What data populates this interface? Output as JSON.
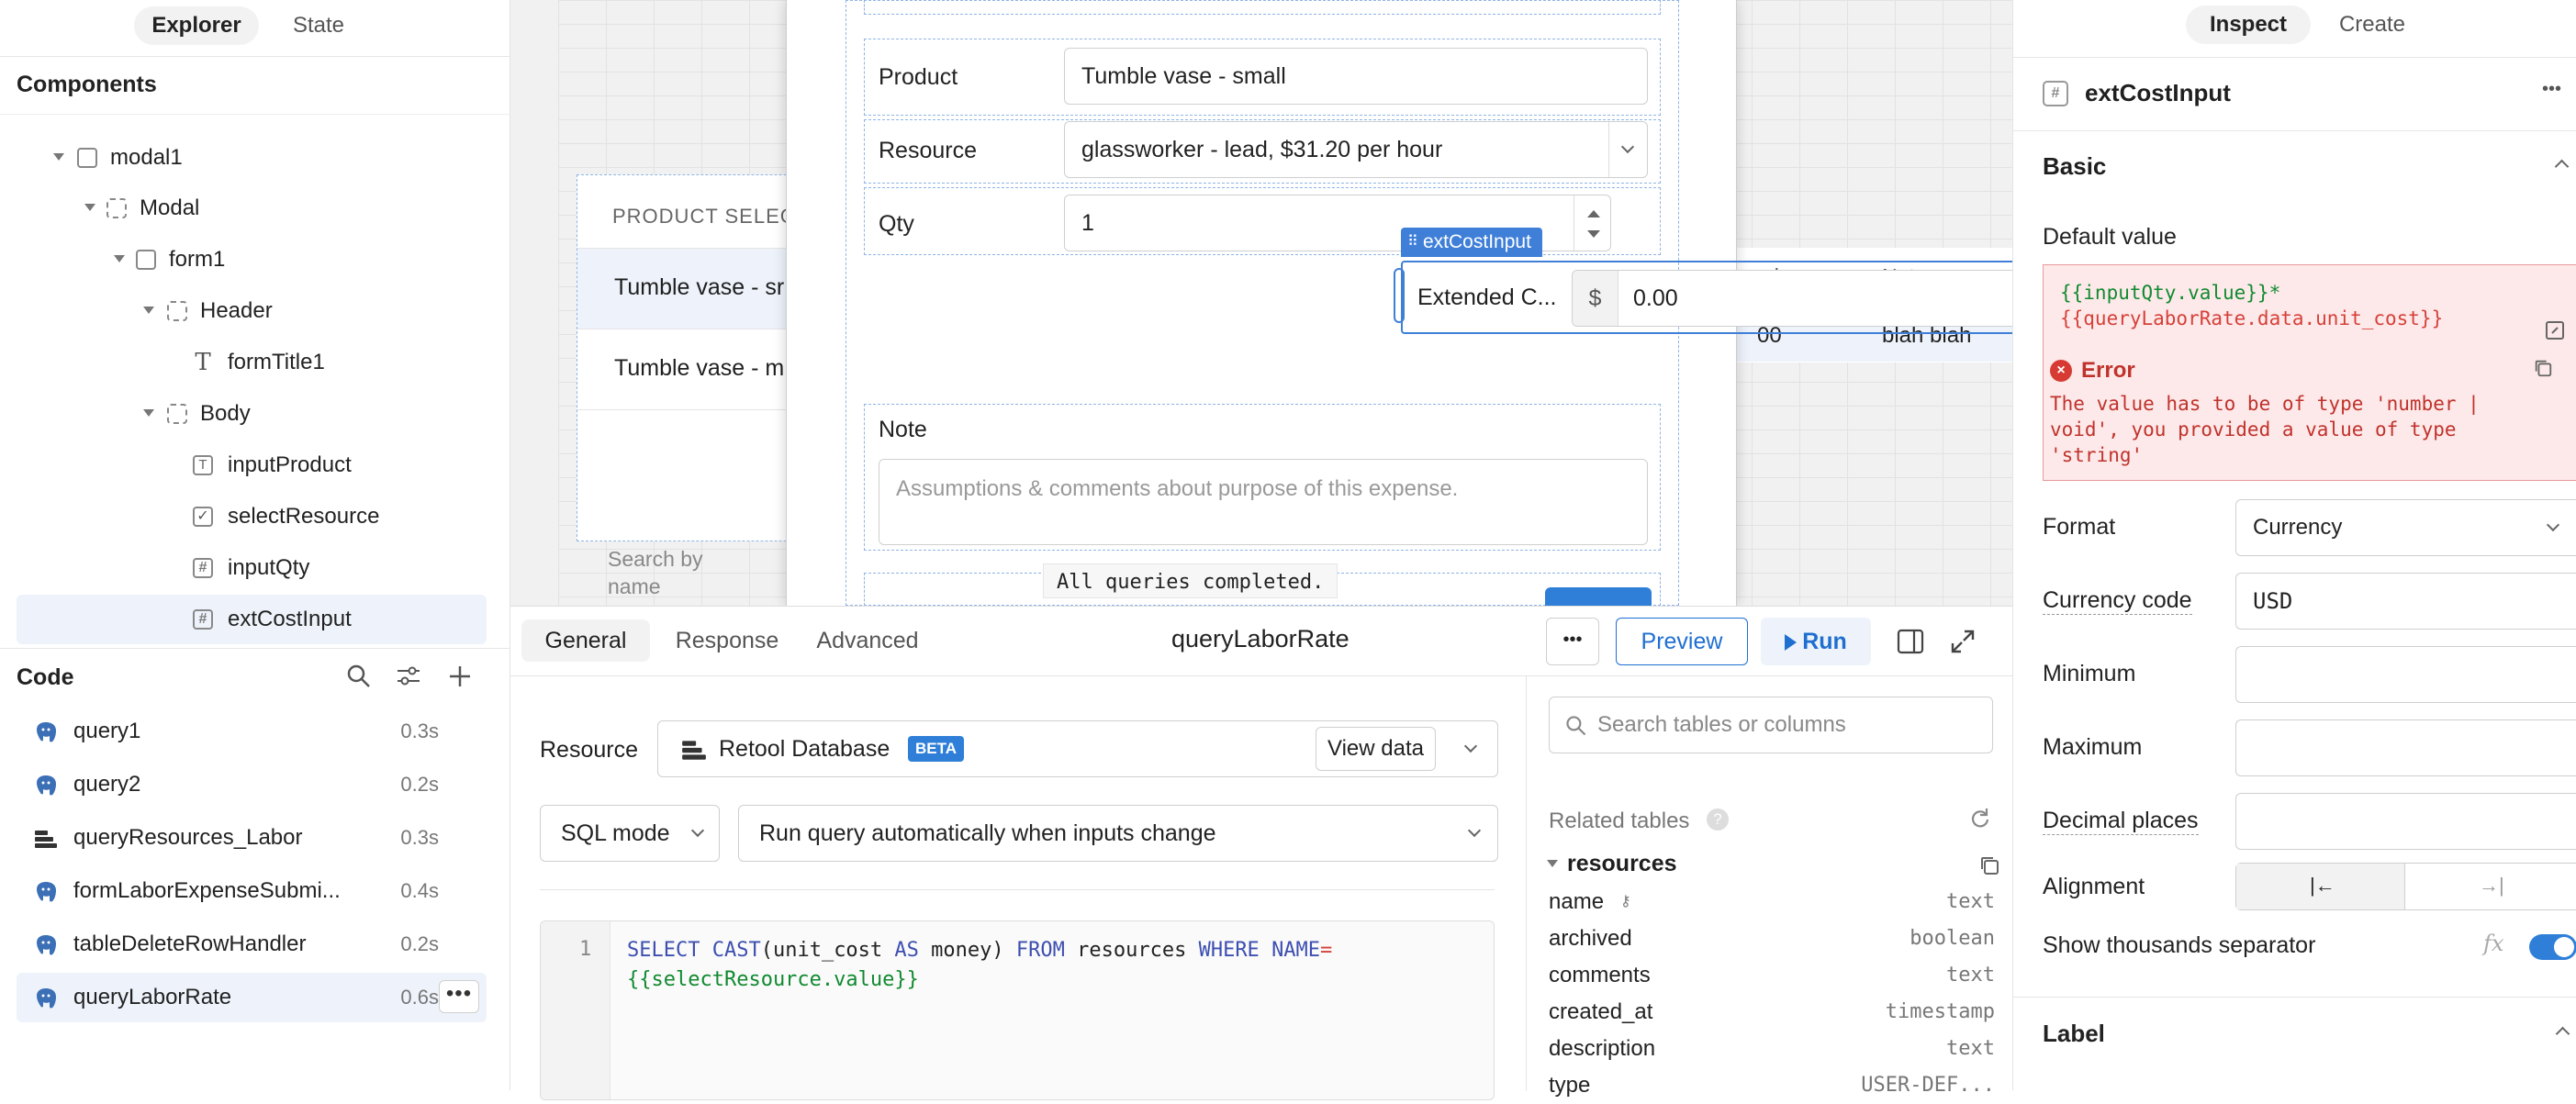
{
  "explorer": {
    "tabs": [
      "Explorer",
      "State"
    ],
    "components_title": "Components",
    "tree": [
      "modal1",
      "Modal",
      "form1",
      "Header",
      "formTitle1",
      "Body",
      "inputProduct",
      "selectResource",
      "inputQty",
      "extCostInput"
    ]
  },
  "code": {
    "title": "Code",
    "queries": [
      {
        "name": "query1",
        "time": "0.3s"
      },
      {
        "name": "query2",
        "time": "0.2s"
      },
      {
        "name": "queryResources_Labor",
        "time": "0.3s"
      },
      {
        "name": "formLaborExpenseSubmi...",
        "time": "0.4s"
      },
      {
        "name": "tableDeleteRowHandler",
        "time": "0.2s"
      },
      {
        "name": "queryLaborRate",
        "time": "0.6s"
      }
    ]
  },
  "canvas": {
    "table_header": "PRODUCT SELEC",
    "table_rows": [
      "Tumble vase - sr",
      "Tumble vase - m"
    ],
    "search_placeholder": "Search by name",
    "right_table_headers": [
      "al",
      "Note"
    ],
    "right_table_row": [
      "00",
      "blah blah"
    ],
    "toast": "All queries completed.",
    "form": {
      "product_label": "Product",
      "product_value": "Tumble vase - small",
      "resource_label": "Resource",
      "resource_value": "glassworker - lead, $31.20 per hour",
      "qty_label": "Qty",
      "qty_value": "1",
      "ext_label": "Extended C...",
      "currency_symbol": "$",
      "ext_value": "0.00",
      "selected_tag": "extCostInput",
      "note_label": "Note",
      "note_placeholder": "Assumptions & comments about purpose of this expense."
    }
  },
  "query_editor": {
    "tabs": [
      "General",
      "Response",
      "Advanced"
    ],
    "name": "queryLaborRate",
    "more": "•••",
    "preview": "Preview",
    "run": "Run",
    "resource_label": "Resource",
    "resource_value": "Retool Database",
    "beta": "BETA",
    "view_data": "View data",
    "mode": "SQL mode",
    "trigger": "Run query automatically when inputs change",
    "line_number": "1",
    "search_placeholder": "Search tables or columns",
    "related_tables": "Related tables",
    "table_name": "resources",
    "columns": [
      {
        "name": "name",
        "type": "text"
      },
      {
        "name": "archived",
        "type": "boolean"
      },
      {
        "name": "comments",
        "type": "text"
      },
      {
        "name": "created_at",
        "type": "timestamp"
      },
      {
        "name": "description",
        "type": "text"
      },
      {
        "name": "type",
        "type": "USER-DEF..."
      }
    ]
  },
  "inspector": {
    "tabs": [
      "Inspect",
      "Create"
    ],
    "component_name": "extCostInput",
    "basic": "Basic",
    "default_value_label": "Default value",
    "default_value_line1": "{{inputQty.value}}*",
    "default_value_line2": "{{queryLaborRate.data.unit_cost}}",
    "error_title": "Error",
    "error_message": "The value has to be of type 'number | void', you provided a value of type 'string'",
    "format_label": "Format",
    "format_value": "Currency",
    "currency_code_label": "Currency code",
    "currency_code_value": "USD",
    "minimum_label": "Minimum",
    "maximum_label": "Maximum",
    "decimal_label": "Decimal places",
    "alignment_label": "Alignment",
    "thousands_label": "Show thousands separator",
    "fx": "fx",
    "thousands_on": true,
    "label_section": "Label"
  }
}
